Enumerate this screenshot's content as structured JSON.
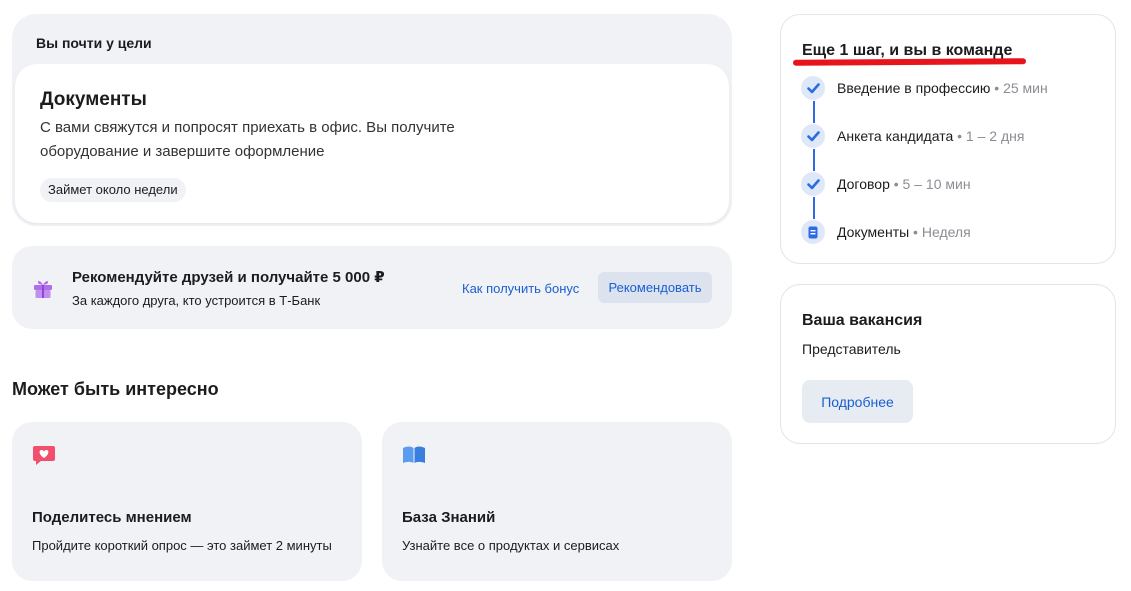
{
  "goal": {
    "title": "Вы почти у цели",
    "document": {
      "heading": "Документы",
      "description": "С вами свяжутся и попросят приехать в офис. Вы получите оборудование и завершите оформление",
      "duration_chip": "Займет около недели"
    }
  },
  "referral": {
    "title": "Рекомендуйте друзей и получайте 5 000 ₽",
    "subtitle": "За каждого друга, кто устроится в Т-Банк",
    "link_label": "Как получить бонус",
    "button_label": "Рекомендовать",
    "icon": "gift-icon"
  },
  "interesting": {
    "heading": "Может быть интересно",
    "cards": [
      {
        "icon": "heart-chat-icon",
        "title": "Поделитесь мнением",
        "subtitle": "Пройдите короткий опрос — это займет 2 минуты"
      },
      {
        "icon": "open-book-icon",
        "title": "База Знаний",
        "subtitle": "Узнайте все о продуктах и сервисах"
      }
    ]
  },
  "steps": {
    "title": "Еще 1 шаг, и вы в команде",
    "items": [
      {
        "label": "Введение в профессию",
        "meta": " • 25 мин",
        "status": "done"
      },
      {
        "label": "Анкета кандидата",
        "meta": " • 1 – 2 дня",
        "status": "done"
      },
      {
        "label": "Договор",
        "meta": " • 5 – 10 мин",
        "status": "done"
      },
      {
        "label": "Документы",
        "meta": " • Неделя",
        "status": "current"
      }
    ]
  },
  "vacancy": {
    "title": "Ваша вакансия",
    "role": "Представитель",
    "button_label": "Подробнее"
  },
  "colors": {
    "accent": "#1a5fd0",
    "card_bg": "#f1f2f6",
    "highlight": "#e8141b",
    "gift": "#b06ee8",
    "heart": "#f0506e",
    "book": "#5b9cf0"
  }
}
